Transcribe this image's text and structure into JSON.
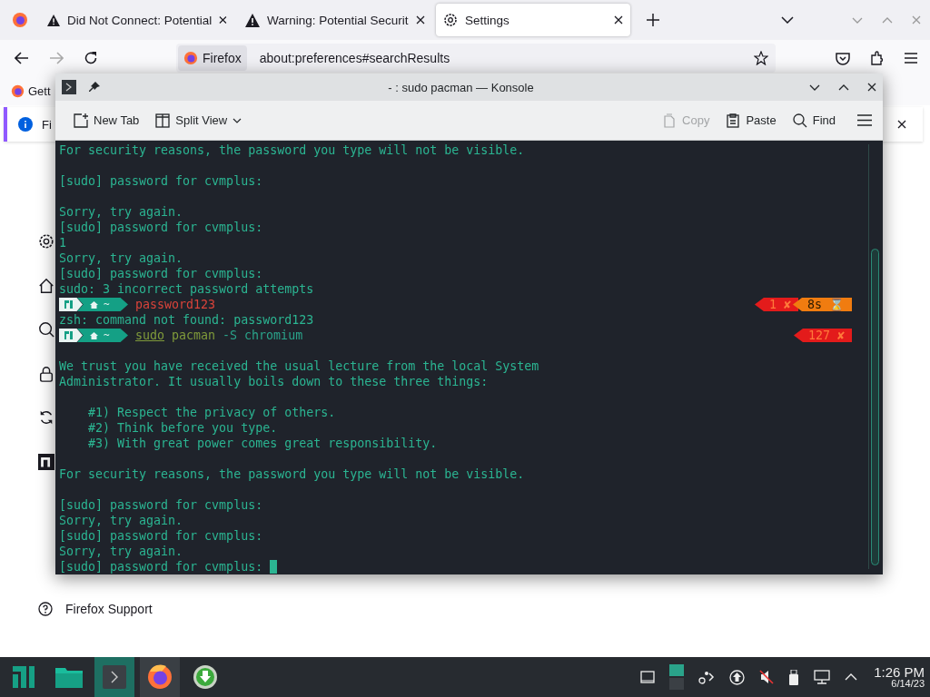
{
  "browser": {
    "tabs": [
      {
        "kind": "pinned",
        "selected": false
      },
      {
        "kind": "warning",
        "title": "Did Not Connect: Potential",
        "selected": false
      },
      {
        "kind": "warning",
        "title": "Warning: Potential Securit",
        "selected": false
      },
      {
        "kind": "settings",
        "title": "Settings",
        "selected": true
      }
    ],
    "nav": {
      "back_disabled": false,
      "forward_disabled": true
    },
    "url": {
      "identity": "Firefox",
      "value": "about:preferences#searchResults"
    },
    "bookmarks": [
      {
        "label": "Gett"
      }
    ],
    "notification": {
      "text": "Fi"
    },
    "sidebar": {
      "items": [
        {
          "kind": "gear"
        },
        {
          "kind": "home"
        },
        {
          "kind": "search"
        },
        {
          "kind": "lock"
        },
        {
          "kind": "sync"
        },
        {
          "kind": "n"
        }
      ],
      "support": "Firefox Support"
    }
  },
  "konsole": {
    "title": "- : sudo pacman — Konsole",
    "toolbar": [
      {
        "kind": "new-tab",
        "label": "New Tab",
        "disabled": false
      },
      {
        "kind": "split",
        "label": "Split View",
        "disabled": false
      },
      {
        "kind": "copy",
        "label": "Copy",
        "disabled": true
      },
      {
        "kind": "paste",
        "label": "Paste",
        "disabled": false
      },
      {
        "kind": "find",
        "label": "Find",
        "disabled": false
      }
    ],
    "lines": [
      {
        "kind": "text",
        "text": "For security reasons, the password you type will not be visible."
      },
      {
        "kind": "blank"
      },
      {
        "kind": "text",
        "text": "[sudo] password for cvmplus:"
      },
      {
        "kind": "blank"
      },
      {
        "kind": "text",
        "text": "Sorry, try again."
      },
      {
        "kind": "text",
        "text": "[sudo] password for cvmplus:"
      },
      {
        "kind": "text",
        "text": "1"
      },
      {
        "kind": "text",
        "text": "Sorry, try again."
      },
      {
        "kind": "text",
        "text": "[sudo] password for cvmplus:"
      },
      {
        "kind": "text",
        "text": "sudo: 3 incorrect password attempts"
      },
      {
        "kind": "prompt",
        "dir": "~",
        "command": [
          {
            "text": "password123",
            "kind": "error"
          }
        ],
        "status": [
          {
            "text": "1 ✘",
            "kind": "error"
          },
          {
            "text": "8s ⌛",
            "kind": "duration"
          }
        ]
      },
      {
        "kind": "text",
        "text": "zsh: command not found: password123"
      },
      {
        "kind": "prompt",
        "dir": "~",
        "command": [
          {
            "text": "sudo",
            "kind": "builtin"
          },
          {
            "text": "pacman",
            "kind": "program"
          },
          {
            "text": "-S chromium",
            "kind": "arg"
          }
        ],
        "status": [
          {
            "text": "127 ✘",
            "kind": "error"
          }
        ]
      },
      {
        "kind": "blank"
      },
      {
        "kind": "text",
        "text": "We trust you have received the usual lecture from the local System"
      },
      {
        "kind": "text",
        "text": "Administrator. It usually boils down to these three things:"
      },
      {
        "kind": "blank"
      },
      {
        "kind": "text",
        "text": "    #1) Respect the privacy of others."
      },
      {
        "kind": "text",
        "text": "    #2) Think before you type."
      },
      {
        "kind": "text",
        "text": "    #3) With great power comes great responsibility."
      },
      {
        "kind": "blank"
      },
      {
        "kind": "text",
        "text": "For security reasons, the password you type will not be visible."
      },
      {
        "kind": "blank"
      },
      {
        "kind": "text",
        "text": "[sudo] password for cvmplus:"
      },
      {
        "kind": "text",
        "text": "Sorry, try again."
      },
      {
        "kind": "text",
        "text": "[sudo] password for cvmplus:"
      },
      {
        "kind": "text",
        "text": "Sorry, try again."
      },
      {
        "kind": "input",
        "text": "[sudo] password for cvmplus: "
      }
    ]
  },
  "taskbar": {
    "apps": [
      {
        "kind": "menu",
        "running": false,
        "selected": false
      },
      {
        "kind": "files",
        "running": false,
        "selected": false
      },
      {
        "kind": "terminal",
        "running": true,
        "selected": true
      },
      {
        "kind": "firefox",
        "running": true,
        "selected": false
      },
      {
        "kind": "download",
        "running": false,
        "selected": false
      }
    ],
    "tray": [
      {
        "kind": "window"
      },
      {
        "kind": "pager"
      },
      {
        "kind": "network-share"
      },
      {
        "kind": "update"
      },
      {
        "kind": "mute"
      },
      {
        "kind": "usb"
      },
      {
        "kind": "network"
      },
      {
        "kind": "expand"
      }
    ],
    "time": "1:26 PM",
    "date": "6/14/23"
  }
}
